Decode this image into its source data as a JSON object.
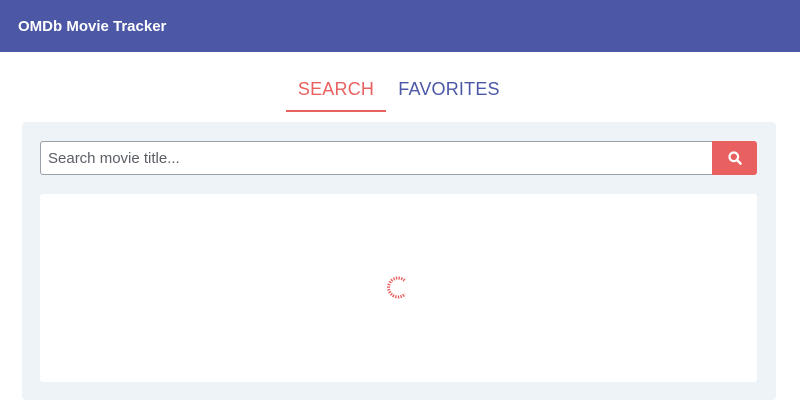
{
  "header": {
    "title": "OMDb Movie Tracker"
  },
  "tabs": [
    {
      "label": "SEARCH",
      "active": true
    },
    {
      "label": "FAVORITES",
      "active": false
    }
  ],
  "search": {
    "placeholder": "Search movie title...",
    "value": "",
    "button_icon": "search-icon"
  },
  "results": {
    "state": "loading",
    "icon": "loading-spinner-icon"
  },
  "colors": {
    "header_bg": "#4c57a6",
    "accent": "#e96060",
    "panel_bg": "#eef3f7"
  }
}
